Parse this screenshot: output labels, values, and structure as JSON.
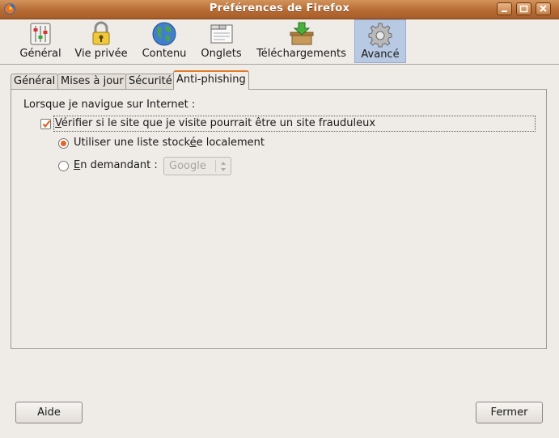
{
  "window": {
    "title": "Préférences de Firefox",
    "icon": "firefox-icon"
  },
  "toolbar": {
    "items": [
      {
        "label": "Général",
        "icon": "sliders-icon"
      },
      {
        "label": "Vie privée",
        "icon": "padlock-icon"
      },
      {
        "label": "Contenu",
        "icon": "globe-icon"
      },
      {
        "label": "Onglets",
        "icon": "tabs-window-icon"
      },
      {
        "label": "Téléchargements",
        "icon": "download-box-icon"
      },
      {
        "label": "Avancé",
        "icon": "gear-icon",
        "active": true
      }
    ]
  },
  "tabs": [
    {
      "label": "Général"
    },
    {
      "label": "Mises à jour"
    },
    {
      "label": "Sécurité"
    },
    {
      "label": "Anti-phishing",
      "active": true
    }
  ],
  "antiphishing": {
    "section_label": "Lorsque je navigue sur Internet :",
    "check_prefix": "V",
    "check_rest": "érifier si le site que je visite pourrait être un site frauduleux",
    "check_checked": true,
    "radio_local_prefix": "Utiliser une liste stock",
    "radio_local_accel": "é",
    "radio_local_rest": "e localement",
    "radio_local_selected": true,
    "radio_ask_prefix": "",
    "radio_ask_accel": "E",
    "radio_ask_rest": "n demandant :",
    "provider_select_value": "Google"
  },
  "buttons": {
    "help": "Aide",
    "close": "Fermer"
  },
  "colors": {
    "titlebar": "#b86b34",
    "active_toolbar": "#b7c9e3",
    "accent": "#d9682a",
    "background": "#efebe7"
  }
}
